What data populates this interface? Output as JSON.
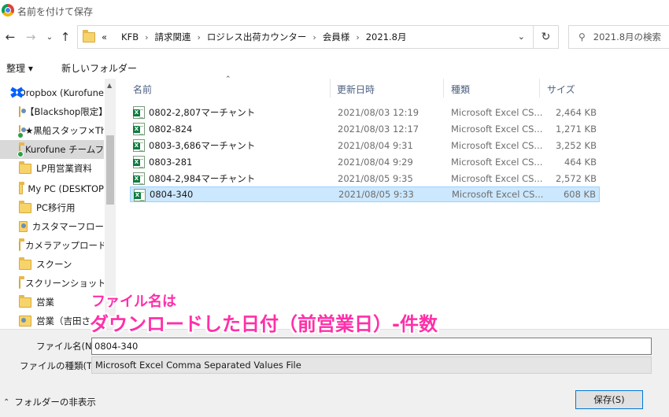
{
  "window": {
    "title": "名前を付けて保存"
  },
  "address": {
    "prefix": "«",
    "crumbs": [
      "KFB",
      "請求関連",
      "ロジレス出荷カウンター",
      "会員様",
      "2021.8月"
    ],
    "separator": "›"
  },
  "search": {
    "placeholder": "2021.8月の検索"
  },
  "toolbar": {
    "organize_label": "整理 ▾",
    "new_folder_label": "新しいフォルダー"
  },
  "nav_pane": {
    "items": [
      {
        "label": "Dropbox (Kurofune",
        "icon": "dropbox-icon",
        "selected": false
      },
      {
        "label": "【Blackshop限定】",
        "icon": "shared-folder-icon",
        "selected": false
      },
      {
        "label": "★黒船スタッフ×Th",
        "icon": "shared-folder-icon",
        "selected": false
      },
      {
        "label": "Kurofune チームフ",
        "icon": "folder-icon",
        "selected": true
      },
      {
        "label": "LP用営業資料",
        "icon": "folder-icon",
        "selected": false
      },
      {
        "label": "My PC (DESKTOP",
        "icon": "folder-icon",
        "selected": false
      },
      {
        "label": "PC移行用",
        "icon": "folder-icon",
        "selected": false
      },
      {
        "label": "カスタマーフロー",
        "icon": "shared-folder-icon",
        "selected": false
      },
      {
        "label": "カメラアップロード",
        "icon": "folder-icon",
        "selected": false
      },
      {
        "label": "スクーン",
        "icon": "folder-icon",
        "selected": false
      },
      {
        "label": "スクリーンショット",
        "icon": "folder-icon",
        "selected": false
      },
      {
        "label": "営業",
        "icon": "folder-icon",
        "selected": false
      },
      {
        "label": "営業（吉田さん",
        "icon": "shared-folder-icon",
        "selected": false
      }
    ]
  },
  "file_list": {
    "columns": {
      "name": "名前",
      "modified": "更新日時",
      "type": "種類",
      "size": "サイズ"
    },
    "rows": [
      {
        "name": "0802-2,807マーチャント",
        "modified": "2021/08/03 12:19",
        "type": "Microsoft Excel CS...",
        "size": "2,464 KB",
        "selected": false
      },
      {
        "name": "0802-824",
        "modified": "2021/08/03 12:17",
        "type": "Microsoft Excel CS...",
        "size": "1,271 KB",
        "selected": false
      },
      {
        "name": "0803-3,686マーチャント",
        "modified": "2021/08/04 9:31",
        "type": "Microsoft Excel CS...",
        "size": "3,252 KB",
        "selected": false
      },
      {
        "name": "0803-281",
        "modified": "2021/08/04 9:29",
        "type": "Microsoft Excel CS...",
        "size": "464 KB",
        "selected": false
      },
      {
        "name": "0804-2,984マーチャント",
        "modified": "2021/08/05 9:35",
        "type": "Microsoft Excel CS...",
        "size": "2,572 KB",
        "selected": false
      },
      {
        "name": "0804-340",
        "modified": "2021/08/05 9:33",
        "type": "Microsoft Excel CS...",
        "size": "608 KB",
        "selected": true
      }
    ]
  },
  "annotation": {
    "line1": "ファイル名は",
    "line2": "ダウンロードした日付（前営業日）-件数",
    "color": "#ff2fa8"
  },
  "form": {
    "filename_label": "ファイル名(N):",
    "filename_value": "0804-340",
    "filetype_label": "ファイルの種類(T):",
    "filetype_value": "Microsoft Excel Comma Separated Values File",
    "hide_folders_label": "フォルダーの非表示",
    "save_label": "保存(S)"
  }
}
